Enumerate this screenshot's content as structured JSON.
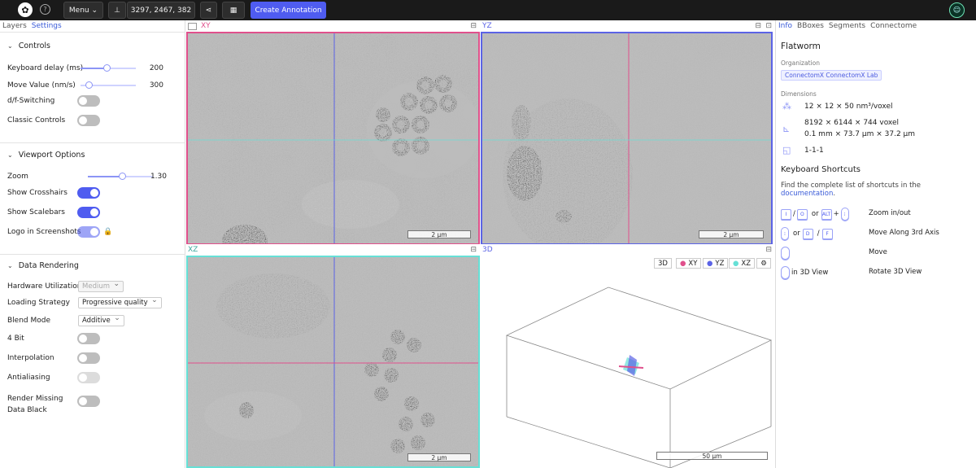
{
  "topbar": {
    "menu_label": "Menu",
    "position": "3297, 2467, 382",
    "create_annotation": "Create Annotation"
  },
  "left": {
    "tabs": [
      "Layers",
      "Settings"
    ],
    "controls": {
      "title": "Controls",
      "keyboard_delay_label": "Keyboard delay (ms)",
      "keyboard_delay_value": "200",
      "move_value_label": "Move Value (nm/s)",
      "move_value_value": "300",
      "df_switching_label": "d/f-Switching",
      "classic_controls_label": "Classic Controls"
    },
    "viewport": {
      "title": "Viewport Options",
      "zoom_label": "Zoom",
      "zoom_value": "1.30",
      "crosshairs_label": "Show Crosshairs",
      "scalebars_label": "Show Scalebars",
      "logo_label": "Logo in Screenshots"
    },
    "rendering": {
      "title": "Data Rendering",
      "hardware_label": "Hardware Utilization",
      "hardware_value": "Medium",
      "loading_label": "Loading Strategy",
      "loading_value": "Progressive quality",
      "blend_label": "Blend Mode",
      "blend_value": "Additive",
      "fourbit_label": "4 Bit",
      "interp_label": "Interpolation",
      "antialias_label": "Antialiasing",
      "missing_label": "Render Missing Data Black"
    }
  },
  "viewports": {
    "xy": "XY",
    "yz": "YZ",
    "xz": "XZ",
    "v3d": "3D",
    "scale_em": "2 µm",
    "scale_3d": "50 µm",
    "buttons_3d": [
      "3D",
      "XY",
      "YZ",
      "XZ"
    ]
  },
  "colors": {
    "xy": "#e0508c",
    "yz": "#5b63e6",
    "xz": "#66e0d6",
    "accent": "#4f5cf0"
  },
  "right": {
    "tabs": [
      "Info",
      "BBoxes",
      "Segments",
      "Connectome"
    ],
    "dataset_name": "Flatworm",
    "org_label": "Organization",
    "org_value": "ConnectomX ConnectomX Lab",
    "dims_label": "Dimensions",
    "voxel_size": "12 × 12 × 50 nm³/voxel",
    "extent_voxel": "8192 × 6144 × 744 voxel",
    "extent_um": "0.1 mm × 73.7 µm × 37.2 µm",
    "mag": "1-1-1",
    "kb_title": "Keyboard Shortcuts",
    "kb_text": "Find the complete list of shortcuts in the",
    "kb_link": "documentation",
    "kb_dot": ".",
    "shortcuts": [
      {
        "keys": [
          "I",
          "/",
          "O",
          "or",
          "ALT",
          "+"
        ],
        "desc": "Zoom in/out"
      },
      {
        "keys": [
          "or",
          "D",
          "/",
          "F"
        ],
        "desc": "Move Along 3rd Axis"
      },
      {
        "keys": [],
        "desc": "Move"
      },
      {
        "keys": [
          "in 3D View"
        ],
        "desc": "Rotate 3D View"
      }
    ]
  }
}
